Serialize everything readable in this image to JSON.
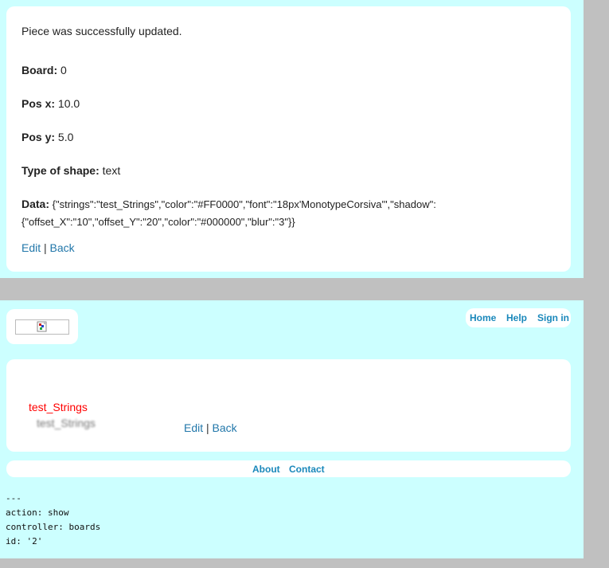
{
  "notice": "Piece was successfully updated.",
  "fields": {
    "board": {
      "label": "Board:",
      "value": "0"
    },
    "pos_x": {
      "label": "Pos x:",
      "value": "10.0"
    },
    "pos_y": {
      "label": "Pos y:",
      "value": "5.0"
    },
    "type": {
      "label": "Type of shape:",
      "value": "text"
    },
    "data": {
      "label": "Data:",
      "line1": "{\"strings\":\"test_Strings\",\"color\":\"#FF0000\",\"font\":\"18px'MonotypeCorsiva'\",\"shadow\":",
      "line2": "{\"offset_X\":\"10\",\"offset_Y\":\"20\",\"color\":\"#000000\",\"blur\":\"3\"}}"
    }
  },
  "piece_links": {
    "edit": "Edit",
    "sep": "|",
    "back": "Back"
  },
  "nav": {
    "home": "Home",
    "help": "Help",
    "sign_in": "Sign in"
  },
  "canvas": {
    "text": "test_Strings",
    "shadow_text": "test_Strings",
    "text_color": "#FF0000",
    "shadow_color": "#000000"
  },
  "board_links": {
    "edit": "Edit",
    "sep": "|",
    "back": "Back"
  },
  "footer": {
    "about": "About",
    "contact": "Contact"
  },
  "debug": {
    "line1": "---",
    "line2": "action: show",
    "line3": "controller: boards",
    "line4": "id: '2'"
  }
}
